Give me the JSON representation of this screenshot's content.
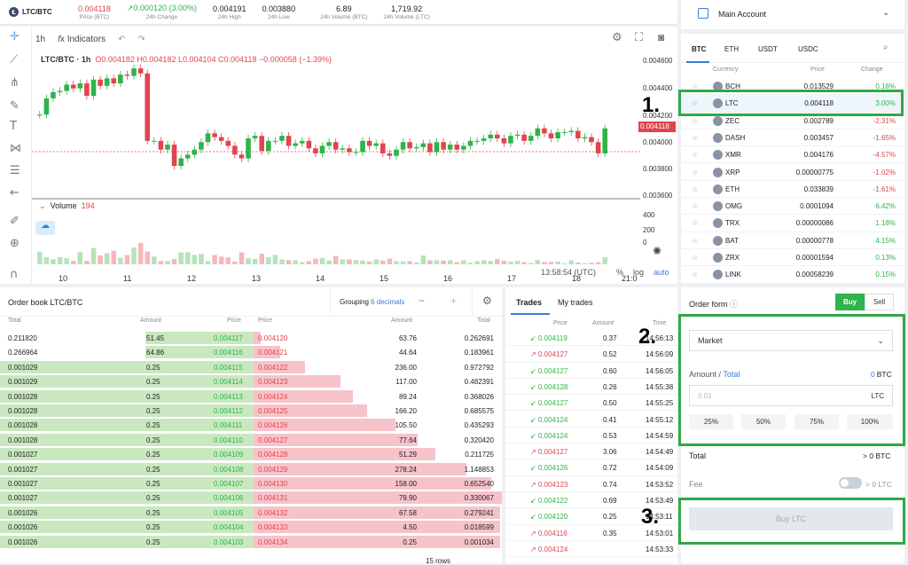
{
  "ticker": {
    "pair": "LTC/BTC",
    "price": "0.004118",
    "price_label": "Price (BTC)",
    "change": "0.000120 (3.00%)",
    "change_label": "24h Change",
    "high": "0.004191",
    "high_label": "24h High",
    "low": "0.003880",
    "low_label": "24h Low",
    "vol_btc": "6.89",
    "vol_btc_label": "24h Volume (BTC)",
    "vol_ltc": "1,719.92",
    "vol_ltc_label": "24h Volume (LTC)"
  },
  "chart": {
    "interval": "1h",
    "indicators": "Indicators",
    "symbol": "LTC/BTC · 1h",
    "o": "O0.004182",
    "h": "H0.004182",
    "l": "L0.004104",
    "c": "C0.004118",
    "chg": "−0.000058 (−1.39%)",
    "volume_label": "Volume",
    "volume_value": "194",
    "price_tag": "0.004118",
    "time": "13:58:54 (UTC)",
    "pct": "%",
    "log": "log",
    "auto": "auto",
    "y_ticks": [
      "0.004600",
      "0.004400",
      "0.004200",
      "0.004000",
      "0.003800",
      "0.003600"
    ],
    "v_ticks": [
      "400",
      "200",
      "0"
    ],
    "x_ticks": [
      "10",
      "11",
      "12",
      "13",
      "14",
      "15",
      "16",
      "17",
      "18",
      "21:0"
    ]
  },
  "chart_data": {
    "type": "candlestick",
    "series": [
      {
        "name": "LTC/BTC",
        "values": [
          0.00423,
          0.00436,
          0.00441,
          0.00442,
          0.00447,
          0.00444,
          0.00448,
          0.00438,
          0.00451,
          0.00446,
          0.00452,
          0.00448,
          0.00455,
          0.00454,
          0.0046,
          0.00456,
          0.00402,
          0.00402,
          0.00395,
          0.00399,
          0.00382,
          0.00388,
          0.00391,
          0.00395,
          0.00401,
          0.00408,
          0.00405,
          0.00402,
          0.00398,
          0.00391,
          0.00388,
          0.00404,
          0.00406,
          0.00394,
          0.00402,
          0.00402,
          0.00406,
          0.00398,
          0.004,
          0.00402,
          0.00396,
          0.00392,
          0.00398,
          0.00401,
          0.00395,
          0.00396,
          0.00393,
          0.00393,
          0.00402,
          0.00398,
          0.004,
          0.00392,
          0.0039,
          0.00395,
          0.00401,
          0.00396,
          0.00397,
          0.004,
          0.00393,
          0.00401,
          0.00395,
          0.00399,
          0.00395,
          0.00398,
          0.00402,
          0.00402,
          0.00404,
          0.00407,
          0.00404,
          0.004,
          0.00406,
          0.00407,
          0.00402,
          0.00406,
          0.00412,
          0.00408,
          0.00404,
          0.00409,
          0.00409,
          0.0041,
          0.00404,
          0.00405,
          0.00401,
          0.00392,
          0.00412
        ]
      },
      {
        "name": "Volume",
        "values": [
          95,
          53,
          38,
          54,
          46,
          26,
          93,
          26,
          122,
          67,
          84,
          102,
          49,
          70,
          126,
          161,
          97,
          58,
          25,
          24,
          40,
          89,
          91,
          71,
          79,
          25,
          70,
          58,
          52,
          21,
          90,
          46,
          41,
          80,
          53,
          71,
          36,
          31,
          31,
          16,
          25,
          43,
          47,
          29,
          63,
          38,
          37,
          32,
          29,
          22,
          37,
          29,
          43,
          24,
          22,
          24,
          14,
          66,
          30,
          30,
          28,
          30,
          16,
          31,
          12,
          24,
          31,
          25,
          41,
          27,
          20,
          26,
          17,
          11,
          32,
          17,
          18,
          21,
          7,
          30,
          13,
          9,
          11,
          16,
          54
        ]
      }
    ],
    "ylim": [
      0.0036,
      0.0047
    ]
  },
  "orderbook": {
    "title": "Order book LTC/BTC",
    "grouping": "Grouping",
    "grouping_val": "6 decimals",
    "minus": "−",
    "plus": "+",
    "cols": [
      "Total",
      "Amount",
      "Price",
      "Price",
      "Amount",
      "Total"
    ],
    "bids": [
      [
        "0.211820",
        "51.45",
        "0.004117"
      ],
      [
        "0.266964",
        "64.86",
        "0.004116"
      ],
      [
        "0.001029",
        "0.25",
        "0.004115"
      ],
      [
        "0.001029",
        "0.25",
        "0.004114"
      ],
      [
        "0.001028",
        "0.25",
        "0.004113"
      ],
      [
        "0.001028",
        "0.25",
        "0.004112"
      ],
      [
        "0.001028",
        "0.25",
        "0.004111"
      ],
      [
        "0.001028",
        "0.25",
        "0.004110"
      ],
      [
        "0.001027",
        "0.25",
        "0.004109"
      ],
      [
        "0.001027",
        "0.25",
        "0.004108"
      ],
      [
        "0.001027",
        "0.25",
        "0.004107"
      ],
      [
        "0.001027",
        "0.25",
        "0.004106"
      ],
      [
        "0.001026",
        "0.25",
        "0.004105"
      ],
      [
        "0.001026",
        "0.25",
        "0.004104"
      ],
      [
        "0.001026",
        "0.25",
        "0.004103"
      ]
    ],
    "asks": [
      [
        "0.004120",
        "63.76",
        "0.262691"
      ],
      [
        "0.004121",
        "44.64",
        "0.183961"
      ],
      [
        "0.004122",
        "236.00",
        "0.972792"
      ],
      [
        "0.004123",
        "117.00",
        "0.482391"
      ],
      [
        "0.004124",
        "89.24",
        "0.368026"
      ],
      [
        "0.004125",
        "166.20",
        "0.685575"
      ],
      [
        "0.004126",
        "105.50",
        "0.435293"
      ],
      [
        "0.004127",
        "77.64",
        "0.320420"
      ],
      [
        "0.004128",
        "51.29",
        "0.211725"
      ],
      [
        "0.004129",
        "278.24",
        "1.148853"
      ],
      [
        "0.004130",
        "158.00",
        "0.652540"
      ],
      [
        "0.004131",
        "79.90",
        "0.330067"
      ],
      [
        "0.004132",
        "67.58",
        "0.279241"
      ],
      [
        "0.004133",
        "4.50",
        "0.018599"
      ],
      [
        "0.004134",
        "0.25",
        "0.001034"
      ]
    ],
    "rows_label": "15 rows"
  },
  "trades": {
    "tab1": "Trades",
    "tab2": "My trades",
    "cols": [
      "Price",
      "Amount",
      "Time"
    ],
    "rows": [
      [
        "0.004119",
        "0.37",
        "14:56:13",
        "up"
      ],
      [
        "0.004127",
        "0.52",
        "14:56:09",
        "down"
      ],
      [
        "0.004127",
        "0.60",
        "14:56:05",
        "up"
      ],
      [
        "0.004128",
        "0.26",
        "14:55:38",
        "up"
      ],
      [
        "0.004127",
        "0.50",
        "14:55:25",
        "up"
      ],
      [
        "0.004124",
        "0.41",
        "14:55:12",
        "up"
      ],
      [
        "0.004124",
        "0.53",
        "14:54:59",
        "up"
      ],
      [
        "0.004127",
        "3.06",
        "14:54:49",
        "down"
      ],
      [
        "0.004126",
        "0.72",
        "14:54:09",
        "up"
      ],
      [
        "0.004123",
        "0.74",
        "14:53:52",
        "down"
      ],
      [
        "0.004122",
        "0.69",
        "14:53:49",
        "up"
      ],
      [
        "0.004120",
        "0.25",
        "14:53:11",
        "up"
      ],
      [
        "0.004116",
        "0.35",
        "14:53:01",
        "down"
      ],
      [
        "0.004124",
        "",
        "14:53:33",
        "down"
      ]
    ]
  },
  "account": {
    "label": "Main Account"
  },
  "market": {
    "tabs": [
      "BTC",
      "ETH",
      "USDT",
      "USDC"
    ],
    "cols": [
      "Currency",
      "Price",
      "Change"
    ],
    "rows": [
      [
        "BCH",
        "0.013529",
        "0.18%",
        "g"
      ],
      [
        "LTC",
        "0.004118",
        "3.00%",
        "g"
      ],
      [
        "ZEC",
        "0.002789",
        "-2.31%",
        "r"
      ],
      [
        "DASH",
        "0.003457",
        "-1.65%",
        "r"
      ],
      [
        "XMR",
        "0.004176",
        "-4.57%",
        "r"
      ],
      [
        "XRP",
        "0.00000775",
        "-1.02%",
        "r"
      ],
      [
        "ETH",
        "0.033839",
        "-1.61%",
        "r"
      ],
      [
        "OMG",
        "0.0001094",
        "6.42%",
        "g"
      ],
      [
        "TRX",
        "0.00000086",
        "1.18%",
        "g"
      ],
      [
        "BAT",
        "0.00000778",
        "4.15%",
        "g"
      ],
      [
        "ZRX",
        "0.00001594",
        "0.13%",
        "g"
      ],
      [
        "LINK",
        "0.00058239",
        "0.15%",
        "g"
      ]
    ]
  },
  "orderform": {
    "title": "Order form",
    "buy": "Buy",
    "sell": "Sell",
    "type": "Market",
    "amount": "Amount",
    "total_link": "Total",
    "balance": "0 BTC",
    "amount_placeholder": "0.01",
    "unit": "LTC",
    "pcts": [
      "25%",
      "50%",
      "75%",
      "100%"
    ],
    "total_label": "Total",
    "total_value": "> 0 BTC",
    "fee_label": "Fee",
    "fee_value": "> 0 LTC",
    "submit": "Buy LTC"
  },
  "annotations": [
    "1.",
    "2.",
    "3."
  ],
  "colors": {
    "up": "#2fb34a",
    "down": "#e0454e",
    "accent": "#2ea84a",
    "link": "#3c7bd6"
  }
}
